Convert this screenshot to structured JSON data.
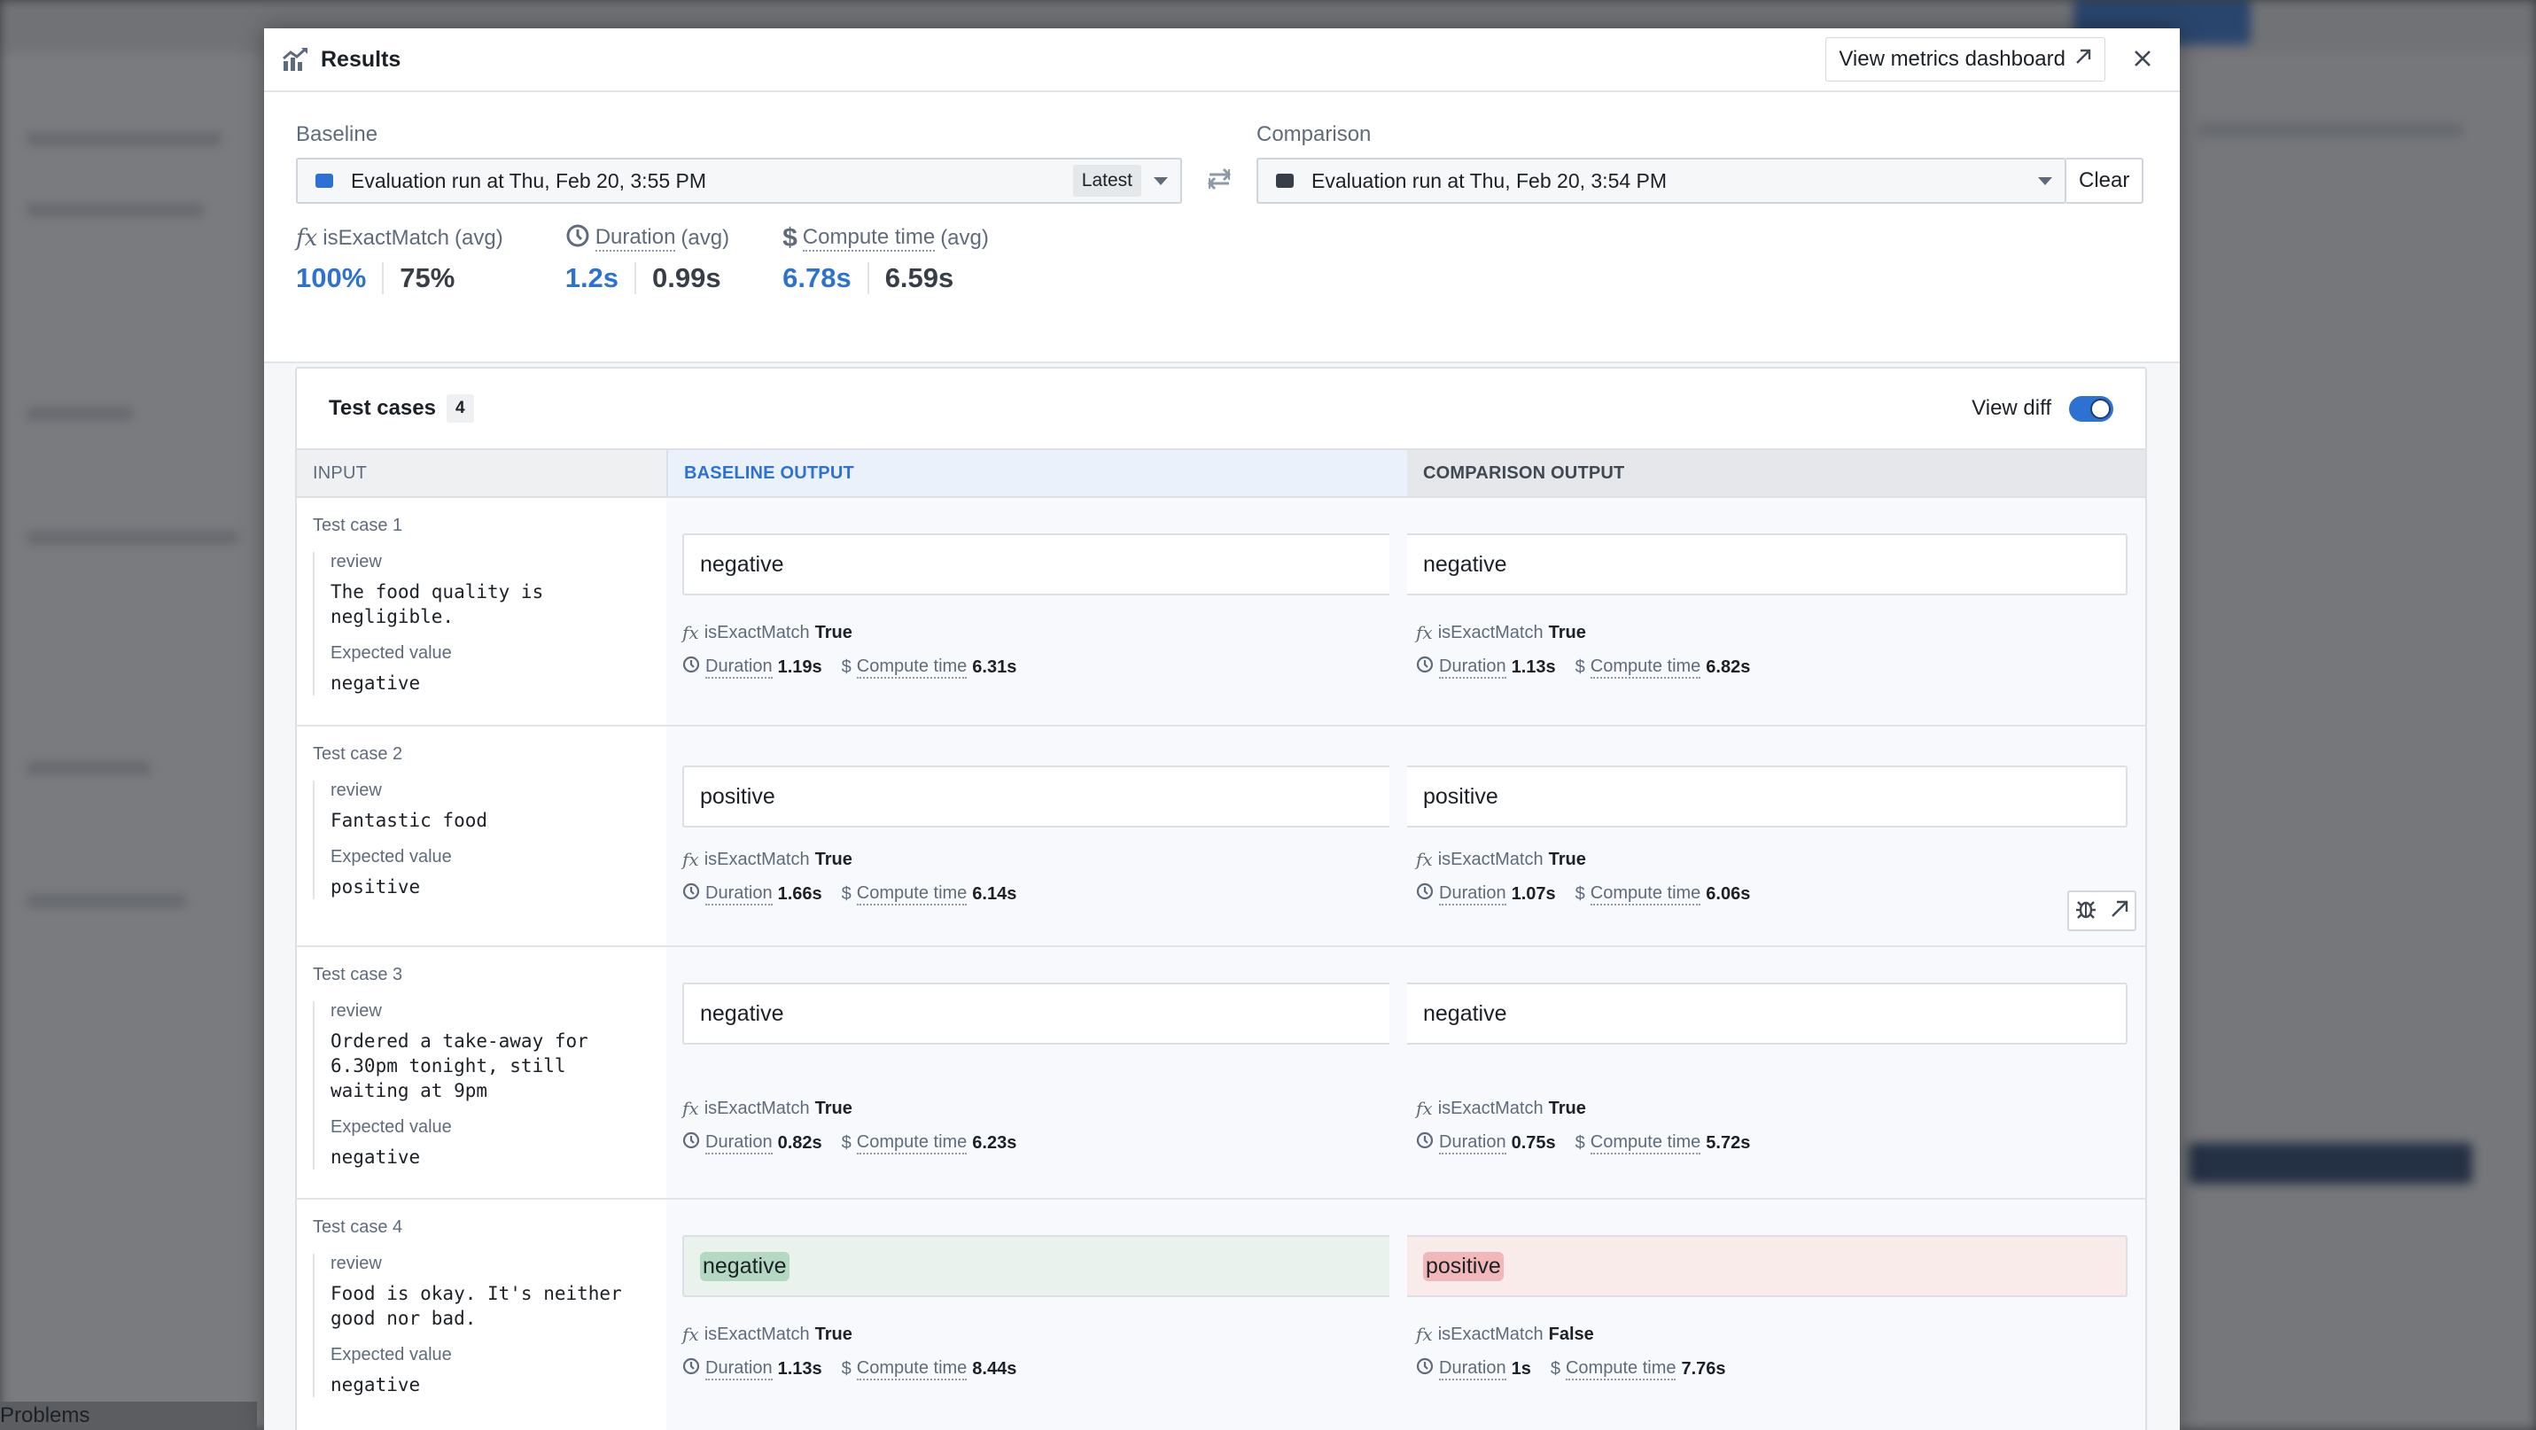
{
  "background": {
    "bottom_panel_tab": "Problems"
  },
  "modal": {
    "title": "Results",
    "dashboard_button": "View metrics dashboard",
    "close_label": "×"
  },
  "selectors": {
    "baseline": {
      "label": "Baseline",
      "value": "Evaluation run at Thu, Feb 20, 3:55 PM",
      "tag": "Latest",
      "swatch_color": "#2d72d2"
    },
    "comparison": {
      "label": "Comparison",
      "value": "Evaluation run at Thu, Feb 20, 3:54 PM",
      "swatch_color": "#383e47",
      "clear_button": "Clear"
    }
  },
  "summary_metrics": [
    {
      "icon": "function-icon",
      "name": "isExactMatch",
      "suffix": "(avg)",
      "baseline": "100%",
      "comparison": "75%"
    },
    {
      "icon": "clock-icon",
      "name": "Duration",
      "suffix": "(avg)",
      "baseline": "1.2s",
      "comparison": "0.99s"
    },
    {
      "icon": "dollar-icon",
      "name": "Compute time",
      "suffix": "(avg)",
      "baseline": "6.78s",
      "comparison": "6.59s"
    }
  ],
  "test_cases": {
    "title": "Test cases",
    "count": "4",
    "view_diff_label": "View diff",
    "view_diff_on": true,
    "columns": [
      "INPUT",
      "BASELINE OUTPUT",
      "COMPARISON OUTPUT"
    ],
    "metric_labels": {
      "match": "isExactMatch",
      "duration": "Duration",
      "compute": "Compute time"
    },
    "rows": [
      {
        "label": "Test case 1",
        "input_key": "review",
        "input_value": "The food quality is negligible.",
        "expected_label": "Expected value",
        "expected_value": "negative",
        "baseline": {
          "output": "negative",
          "match": "True",
          "duration": "1.19s",
          "compute": "6.31s"
        },
        "comparison": {
          "output": "negative",
          "match": "True",
          "duration": "1.13s",
          "compute": "6.82s"
        }
      },
      {
        "label": "Test case 2",
        "input_key": "review",
        "input_value": "Fantastic food",
        "expected_label": "Expected value",
        "expected_value": "positive",
        "baseline": {
          "output": "positive",
          "match": "True",
          "duration": "1.66s",
          "compute": "6.14s"
        },
        "comparison": {
          "output": "positive",
          "match": "True",
          "duration": "1.07s",
          "compute": "6.06s"
        }
      },
      {
        "label": "Test case 3",
        "input_key": "review",
        "input_value": "Ordered a take-away for 6.30pm tonight, still waiting at 9pm",
        "expected_label": "Expected value",
        "expected_value": "negative",
        "baseline": {
          "output": "negative",
          "match": "True",
          "duration": "0.82s",
          "compute": "6.23s"
        },
        "comparison": {
          "output": "negative",
          "match": "True",
          "duration": "0.75s",
          "compute": "5.72s"
        }
      },
      {
        "label": "Test case 4",
        "input_key": "review",
        "input_value": "Food is okay. It's neither good nor bad.",
        "expected_label": "Expected value",
        "expected_value": "negative",
        "baseline": {
          "output": "negative",
          "match": "True",
          "duration": "1.13s",
          "compute": "8.44s"
        },
        "comparison": {
          "output": "positive",
          "match": "False",
          "duration": "1s",
          "compute": "7.76s"
        }
      }
    ]
  },
  "colors": {
    "accent": "#2d72d2",
    "diff_removed": "#b5d8c2",
    "diff_added": "#f0b8b8"
  }
}
